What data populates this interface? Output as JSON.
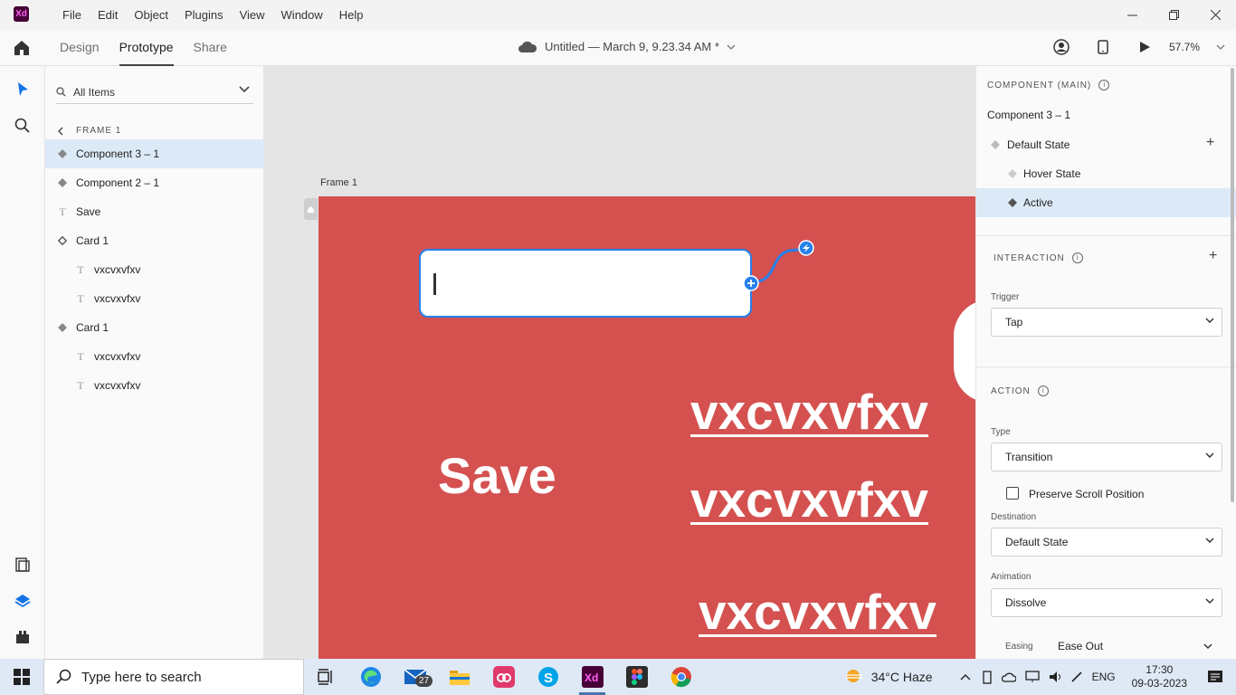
{
  "app": {
    "logo": "Xd"
  },
  "menu": [
    "File",
    "Edit",
    "Object",
    "Plugins",
    "View",
    "Window",
    "Help"
  ],
  "toolbar": {
    "modes": [
      "Design",
      "Prototype",
      "Share"
    ],
    "active_mode": "Prototype",
    "doc_title": "Untitled — March 9, 9.23.34 AM *",
    "zoom": "57.7%"
  },
  "layers": {
    "filter": "All Items",
    "frame": "FRAME 1",
    "items": [
      {
        "label": "Component 3 – 1",
        "icon": "component-main-icon",
        "indent": 0,
        "selected": true
      },
      {
        "label": "Component 2 – 1",
        "icon": "component-main-icon",
        "indent": 0,
        "selected": false
      },
      {
        "label": "Save",
        "icon": "text-icon",
        "indent": 0,
        "selected": false
      },
      {
        "label": "Card 1",
        "icon": "component-instance-icon",
        "indent": 0,
        "selected": false
      },
      {
        "label": "vxcvxvfxv",
        "icon": "text-icon",
        "indent": 1,
        "selected": false
      },
      {
        "label": "vxcvxvfxv",
        "icon": "text-icon",
        "indent": 1,
        "selected": false
      },
      {
        "label": "Card 1",
        "icon": "component-main-icon",
        "indent": 0,
        "selected": false
      },
      {
        "label": "vxcvxvfxv",
        "icon": "text-icon",
        "indent": 1,
        "selected": false
      },
      {
        "label": "vxcvxvfxv",
        "icon": "text-icon",
        "indent": 1,
        "selected": false
      }
    ]
  },
  "canvas": {
    "frame_name": "Frame 1",
    "save_text": "Save",
    "vx_texts": [
      "vxcvxvfxv",
      "vxcvxvfxv",
      "vxcvxvfxv"
    ],
    "artboard_color": "#d45150",
    "wire_color": "#2680eb"
  },
  "properties": {
    "component_title": "COMPONENT (MAIN)",
    "component_name": "Component 3 – 1",
    "states": [
      {
        "label": "Default State",
        "selected": false
      },
      {
        "label": "Hover State",
        "selected": false
      },
      {
        "label": "Active",
        "selected": true
      }
    ],
    "interaction_title": "INTERACTION",
    "trigger_label": "Trigger",
    "trigger_value": "Tap",
    "action_title": "ACTION",
    "type_label": "Type",
    "type_value": "Transition",
    "preserve_label": "Preserve Scroll Position",
    "preserve_checked": false,
    "destination_label": "Destination",
    "destination_value": "Default State",
    "animation_label": "Animation",
    "animation_value": "Dissolve",
    "easing_label": "Easing",
    "easing_value": "Ease Out"
  },
  "taskbar": {
    "search_placeholder": "Type here to search",
    "mail_badge": "27",
    "weather": "34°C  Haze",
    "lang": "ENG",
    "time": "17:30",
    "date": "09-03-2023"
  }
}
